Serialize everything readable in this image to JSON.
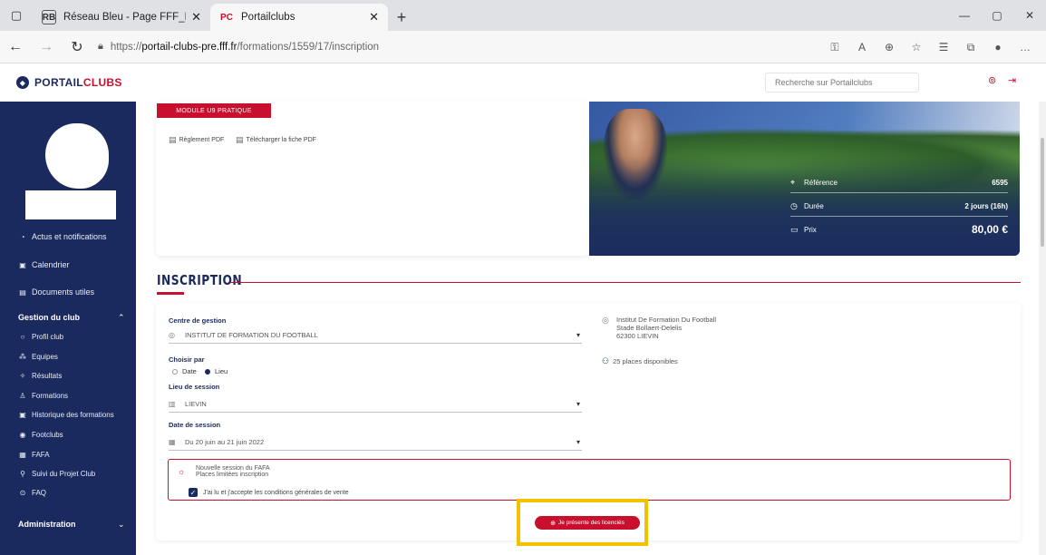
{
  "browser": {
    "tabs": [
      {
        "title": "Réseau Bleu - Page FFF_PRIVATE",
        "favicon": "RB"
      },
      {
        "title": "Portailclubs",
        "favicon": "PC"
      }
    ],
    "url_prefix": "https://",
    "url_host": "portail-clubs-pre.fff.fr",
    "url_path": "/formations/1559/17/inscription"
  },
  "header": {
    "logo_main": "PORTAIL",
    "logo_accent": "CLUBS",
    "search_placeholder": "Recherche sur Portailclubs"
  },
  "sidebar": {
    "items": [
      {
        "label": "Actus et notifications",
        "icon": "bell-icon"
      },
      {
        "label": "Calendrier",
        "icon": "calendar-icon"
      },
      {
        "label": "Documents utiles",
        "icon": "document-icon"
      }
    ],
    "section_club": "Gestion du club",
    "sub_items": [
      {
        "label": "Profil club",
        "icon": "circle-icon"
      },
      {
        "label": "Equipes",
        "icon": "team-icon"
      },
      {
        "label": "Résultats",
        "icon": "results-icon"
      },
      {
        "label": "Formations",
        "icon": "training-icon"
      },
      {
        "label": "Historique des formations",
        "icon": "history-icon"
      },
      {
        "label": "Footclubs",
        "icon": "footclubs-icon"
      },
      {
        "label": "FAFA",
        "icon": "fafa-icon"
      },
      {
        "label": "Suivi du Projet Club",
        "icon": "project-icon"
      },
      {
        "label": "FAQ",
        "icon": "faq-icon"
      }
    ],
    "section_admin": "Administration"
  },
  "hero": {
    "tag": "MODULE U9 PRATIQUE",
    "links": [
      "Règlement PDF",
      "Télécharger la fiche PDF"
    ],
    "reference_label": "Référence",
    "reference_value": "6595",
    "duration_label": "Durée",
    "duration_value": "2 jours (16h)",
    "price_label": "Prix",
    "price_value": "80,00 €"
  },
  "inscription": {
    "title": "INSCRIPTION",
    "centre_label": "Centre de gestion",
    "centre_value": "INSTITUT DE FORMATION DU FOOTBALL",
    "choose_label": "Choisir par",
    "choose_option_1": "Date",
    "choose_option_2": "Lieu",
    "lieu_label": "Lieu de session",
    "lieu_value": "LIEVIN",
    "date_label": "Date de session",
    "date_value": "Du 20 juin au 21 juin 2022",
    "address_lines": [
      "Institut De Formation Du Football",
      "Stade Bollaert-Delelis",
      "62300 LIEVIN"
    ],
    "places": "25 places disponibles",
    "notice_line_1": "Nouvelle session du FAFA",
    "notice_line_2": "Places limitées inscription",
    "notice_check": "J'ai lu et j'accepte les conditions générales de vente",
    "cta": "Je présente des licenciés"
  }
}
